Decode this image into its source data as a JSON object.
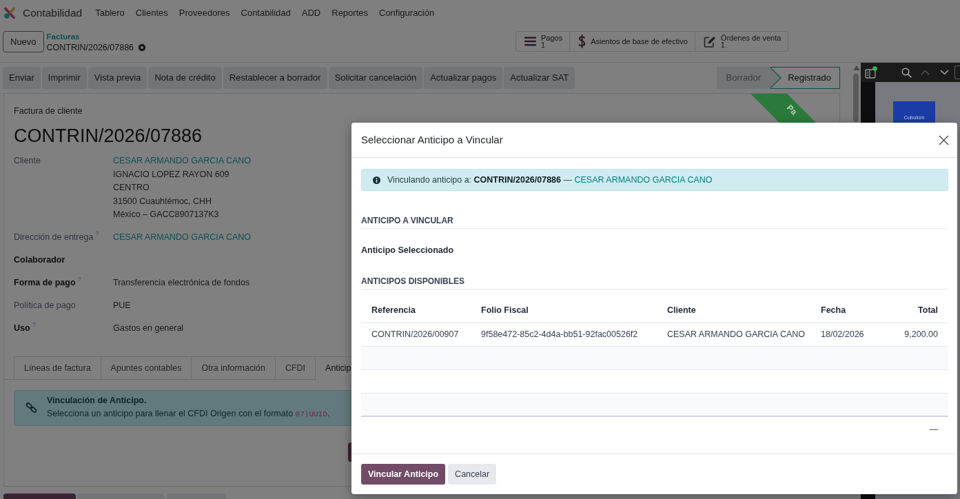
{
  "navbar": {
    "app_name": "Contabilidad",
    "menu": [
      "Tablero",
      "Clientes",
      "Proveedores",
      "Contabilidad",
      "ADD",
      "Reportes",
      "Configuración"
    ]
  },
  "control_panel": {
    "new_button": "Nuevo",
    "breadcrumb": "Facturas",
    "record_name": "CONTRIN/2026/07886",
    "smart_buttons": [
      {
        "kind": "list",
        "label": "Pagos",
        "count": "1"
      },
      {
        "kind": "dollar",
        "label": "Asientos de base de efectivo"
      },
      {
        "kind": "edit",
        "label": "Órdenes de venta",
        "count": "1"
      }
    ]
  },
  "action_buttons": [
    "Enviar",
    "Imprimir",
    "Vista previa",
    "Nota de crédito",
    "Restablecer a borrador",
    "Solicitar cancelación",
    "Actualizar pagos",
    "Actualizar SAT"
  ],
  "status_steps": [
    {
      "label": "Borrador",
      "selected": false
    },
    {
      "label": "Registrado",
      "selected": true
    }
  ],
  "form": {
    "ribbon": "Pa",
    "subtitle": "Factura de cliente",
    "title": "CONTRIN/2026/07886",
    "fields": [
      {
        "label": "Cliente",
        "bold": false,
        "lines": [
          {
            "kind": "link",
            "text": "CESAR ARMANDO GARCIA CANO"
          },
          {
            "kind": "text",
            "text": "IGNACIO LOPEZ RAYON 609"
          },
          {
            "kind": "text",
            "text": "CENTRO"
          },
          {
            "kind": "text",
            "text": "31500 Cuauhtémoc, CHH"
          },
          {
            "kind": "text",
            "text": "México – GACC8907137K3"
          }
        ]
      },
      {
        "label": "Dirección de entrega",
        "help": "?",
        "bold": false,
        "lines": [
          {
            "kind": "link",
            "text": "CESAR ARMANDO GARCIA CANO"
          }
        ]
      },
      {
        "label": "Colaborador",
        "bold": true
      },
      {
        "label": "Forma de pago",
        "help": "?",
        "bold": true,
        "lines": [
          {
            "kind": "text",
            "text": "Transferencia electrónica de fondos"
          }
        ]
      },
      {
        "label": "Política de pago",
        "bold": false,
        "lines": [
          {
            "kind": "text",
            "text": "PUE"
          }
        ]
      },
      {
        "label": "Uso",
        "help": "?",
        "bold": true,
        "lines": [
          {
            "kind": "text",
            "text": "Gastos en general"
          }
        ]
      }
    ],
    "tabs": [
      {
        "label": "Líneas de factura",
        "selected": false
      },
      {
        "label": "Apuntes contables",
        "selected": false
      },
      {
        "label": "Otra información",
        "selected": false
      },
      {
        "label": "CFDI",
        "selected": false
      },
      {
        "label": "Anticip",
        "selected": true
      }
    ],
    "alert": {
      "title": "Vinculación de Anticipo.",
      "text": "Selecciona un anticipo para llenar el CFDI Origen con el formato ",
      "code": "07|UUID",
      "text_end": "."
    }
  },
  "side_panel": {
    "document_logo": "Cubulom"
  },
  "dialog": {
    "title": "Seleccionar Anticipo a Vincular",
    "info": {
      "text": "Vinculando anticipo a: **CONTRIN/2026/07886** —",
      "link": "CESAR ARMANDO GARCIA CANO"
    },
    "section_selected": "ANTICIPO A VINCULAR",
    "selected_label": "Anticipo Seleccionado",
    "section_available": "ANTICIPOS DISPONIBLES",
    "table": {
      "columns": [
        "Referencia",
        "Folio Fiscal",
        "Cliente",
        "Fecha",
        "Total"
      ],
      "rows": [
        [
          "CONTRIN/2026/00907",
          "9f58e472-85c2-4d4a-bb51-92fac00526f2",
          "CESAR ARMANDO GARCIA CANO",
          "18/02/2026",
          "9,200.00"
        ]
      ],
      "footer_total": "—"
    },
    "buttons": [
      {
        "kind": "primary",
        "label": "Vincular Anticipo"
      },
      {
        "kind": "secondary",
        "label": "Cancelar"
      }
    ]
  }
}
